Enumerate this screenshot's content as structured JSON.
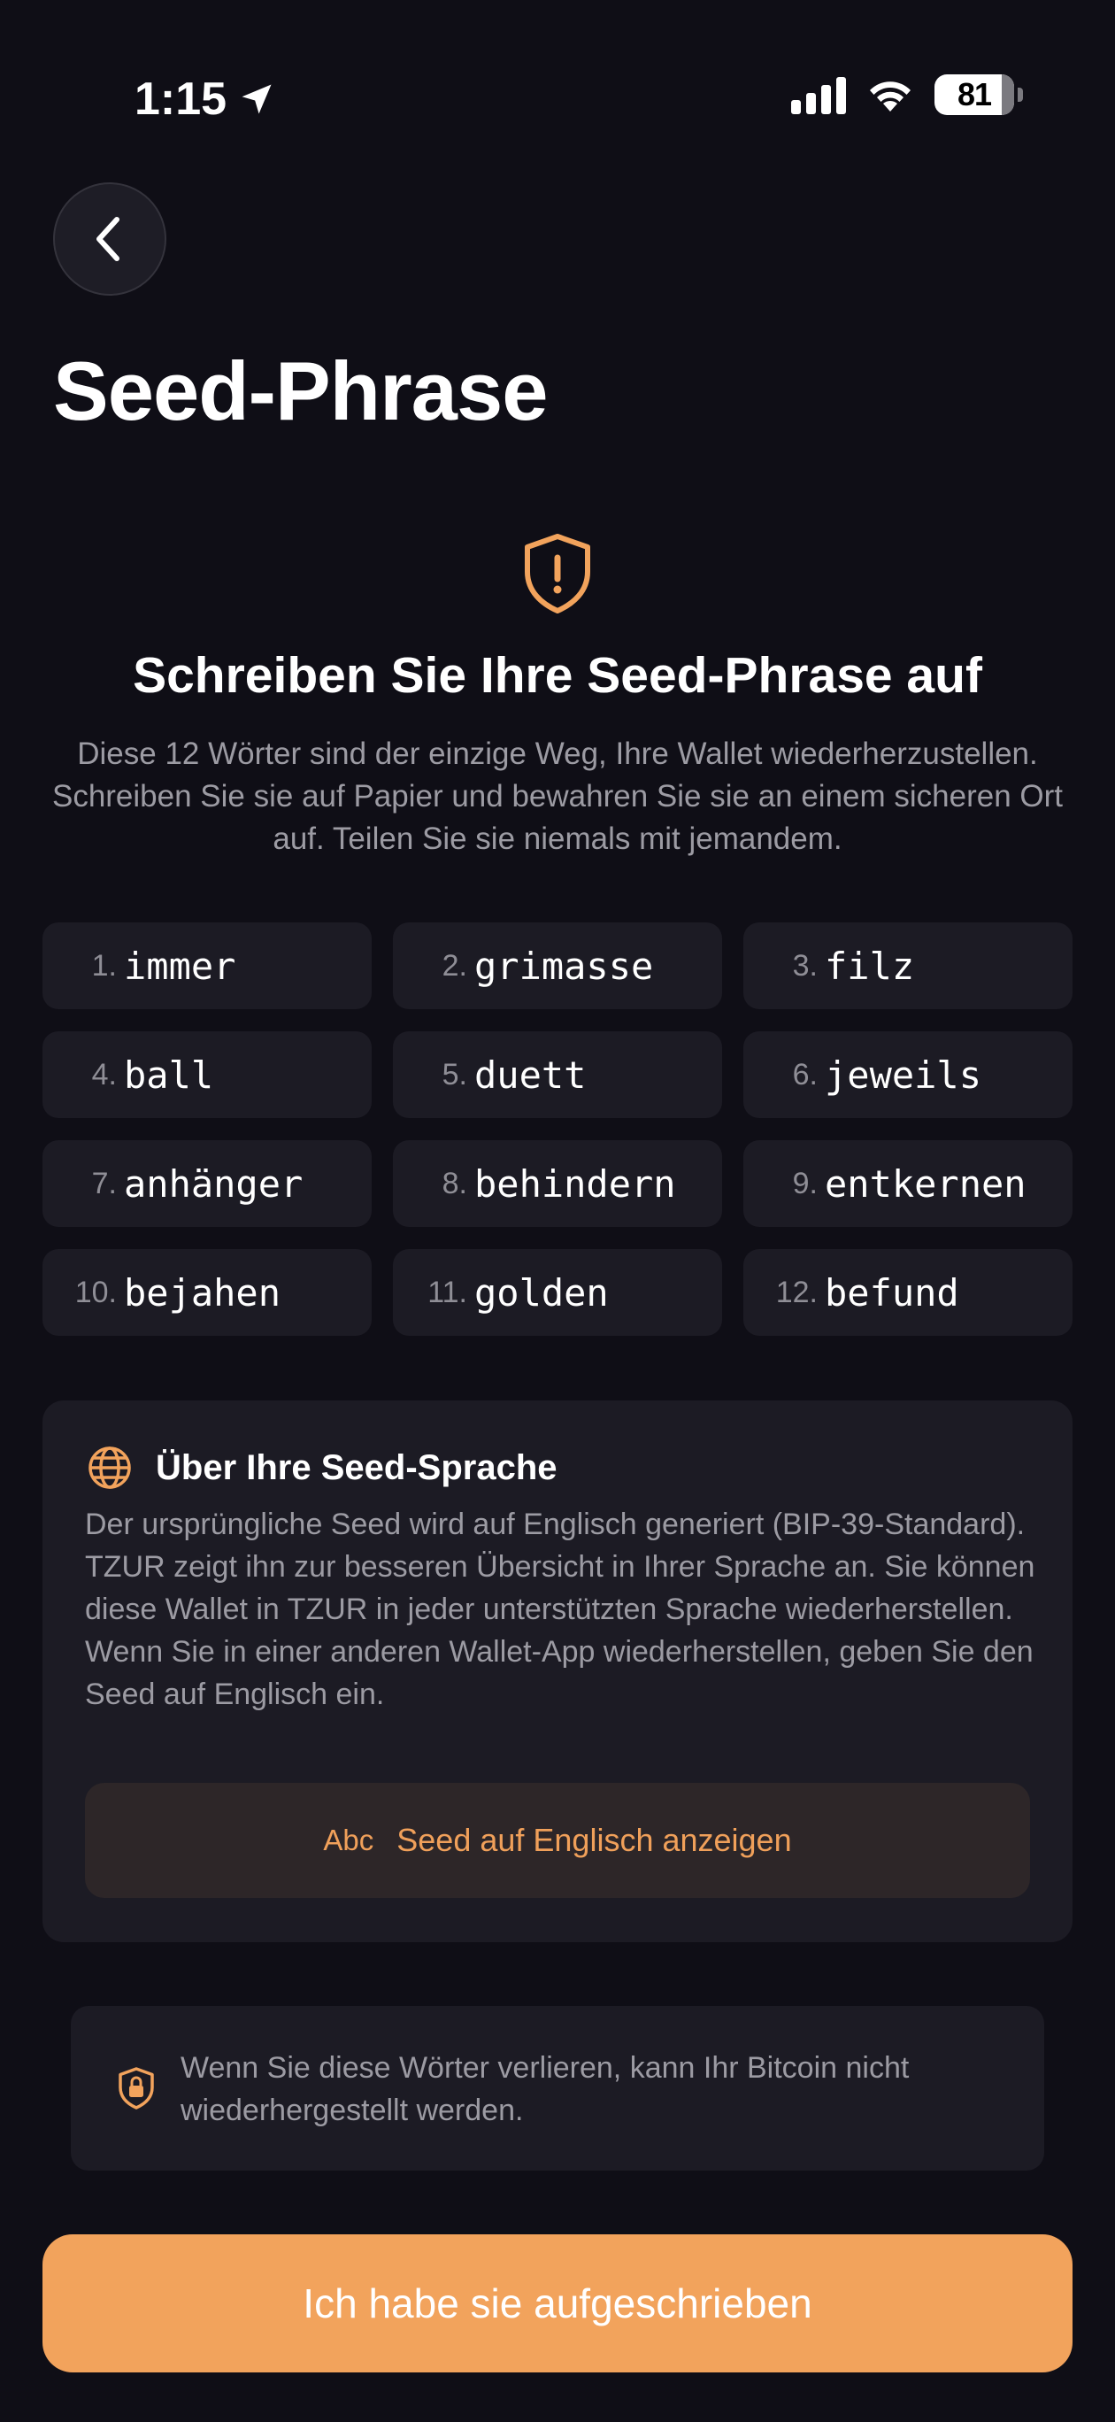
{
  "status_bar": {
    "time": "1:15",
    "battery_level": "81"
  },
  "header": {
    "title": "Seed-Phrase"
  },
  "intro": {
    "headline": "Schreiben Sie Ihre Seed-Phrase auf",
    "description": "Diese 12 Wörter sind der einzige Weg, Ihre Wallet wiederherzustellen. Schreiben Sie sie auf Papier und bewahren Sie sie an einem sicheren Ort auf. Teilen Sie sie niemals mit jemandem."
  },
  "words": [
    {
      "num": "1.",
      "word": "immer"
    },
    {
      "num": "2.",
      "word": "grimasse"
    },
    {
      "num": "3.",
      "word": "filz"
    },
    {
      "num": "4.",
      "word": "ball"
    },
    {
      "num": "5.",
      "word": "duett"
    },
    {
      "num": "6.",
      "word": "jeweils"
    },
    {
      "num": "7.",
      "word": "anhänger"
    },
    {
      "num": "8.",
      "word": "behindern"
    },
    {
      "num": "9.",
      "word": "entkernen"
    },
    {
      "num": "10.",
      "word": "bejahen"
    },
    {
      "num": "11.",
      "word": "golden"
    },
    {
      "num": "12.",
      "word": "befund"
    }
  ],
  "info_card": {
    "title": "Über Ihre Seed-Sprache",
    "body": "Der ursprüngliche Seed wird auf Englisch generiert (BIP-39-Standard). TZUR zeigt ihn zur besseren Übersicht in Ihrer Sprache an. Sie können diese Wallet in TZUR in jeder unterstützten Sprache wiederherstellen. Wenn Sie in einer anderen Wallet-App wiederherstellen, geben Sie den Seed auf Englisch ein.",
    "button_icon_text": "Abc",
    "button_label": "Seed auf Englisch anzeigen"
  },
  "warning": {
    "text": "Wenn Sie diese Wörter verlieren, kann Ihr Bitcoin nicht wiederhergestellt werden."
  },
  "confirm_button": {
    "label": "Ich habe sie aufgeschrieben"
  },
  "icons": {
    "back": "chevron-left-icon",
    "shield": "shield-exclamation-icon",
    "globe": "globe-icon",
    "lock": "shield-lock-icon",
    "location": "location-arrow-icon",
    "signal": "cellular-signal-icon",
    "wifi": "wifi-icon",
    "battery": "battery-icon"
  },
  "colors": {
    "background": "#0f0e16",
    "card": "#1c1b24",
    "accent": "#f2a35c",
    "muted_text": "#9c9ba3"
  }
}
